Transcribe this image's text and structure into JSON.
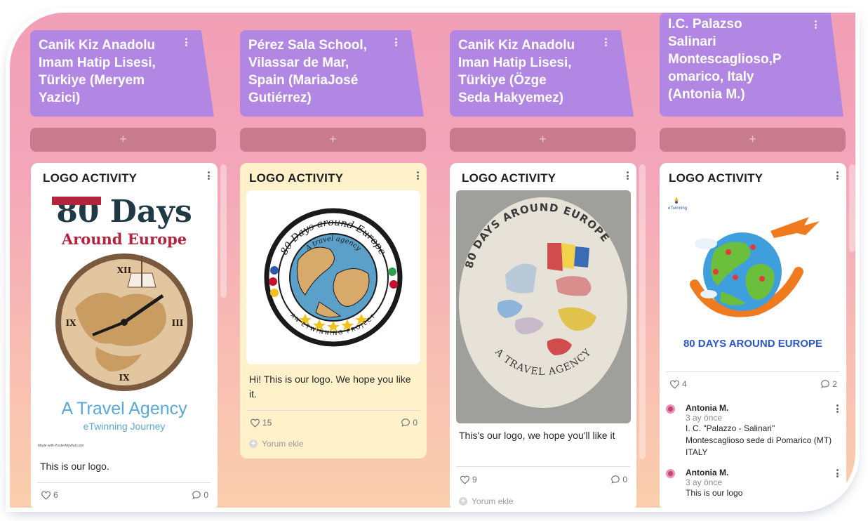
{
  "columns": [
    {
      "header": "Canik Kiz Anadolu\nImam Hatip Lisesi,\nTürkiye (Meryem\nYazici)",
      "add": "+",
      "card": {
        "title": "LOGO ACTIVITY",
        "logo": {
          "line1": "80 Days",
          "line2": "Around Europe",
          "line3": "A Travel Agency",
          "line4": "eTwinning Journey",
          "footer": "Made with PosterMyWall.com"
        },
        "text": "This is our logo.",
        "likes": "6",
        "comments": "0"
      }
    },
    {
      "header": "Pérez Sala School,\nVilassar de Mar,\nSpain (MariaJosé\nGutiérrez)",
      "add": "+",
      "card": {
        "title": "LOGO ACTIVITY",
        "logo": {
          "top": "80 Days around Europe",
          "inner": "A travel agency",
          "bottom": "AN ETWINNING PROJECT"
        },
        "text": "Hi! This is our logo. We hope you like it.",
        "likes": "15",
        "comments": "0",
        "add_comment": "Yorum ekle"
      }
    },
    {
      "header": "Canik Kiz Anadolu\nIman Hatip Lisesi,\nTürkiye (Özge\nSeda Hakyemez)",
      "add": "+",
      "card": {
        "title": "LOGO ACTIVITY",
        "logo": {
          "top": "80 DAYS AROUND EUROPE",
          "bottom": "A TRAVEL AGENCY"
        },
        "text": "This's our logo, we hope you'll like it",
        "likes": "9",
        "comments": "0",
        "add_comment": "Yorum ekle"
      }
    },
    {
      "header": "I.C. Palazso\nSalinari\nMontescaglioso,P\nomarico, Italy\n(Antonia M.)",
      "add": "+",
      "card": {
        "title": "LOGO ACTIVITY",
        "logo": {
          "badge": "eTwinning",
          "caption": "80 DAYS AROUND EUROPE"
        },
        "likes": "4",
        "comments": "2",
        "comment_list": [
          {
            "author": "Antonia M.",
            "time": "3 ay önce",
            "body": "I. C. \"Palazzo - Salinari\" Montescaglioso sede di Pomarico (MT) ITALY"
          },
          {
            "author": "Antonia M.",
            "time": "3 ay önce",
            "body": "This is our logo"
          }
        ]
      }
    }
  ],
  "colors": {
    "header": "#b187e3",
    "add_bar": "#c77b8d",
    "card_yellow": "#fff1c9"
  },
  "icons": [
    "heart-icon",
    "comment-icon",
    "more-vertical-icon",
    "plus-icon"
  ]
}
